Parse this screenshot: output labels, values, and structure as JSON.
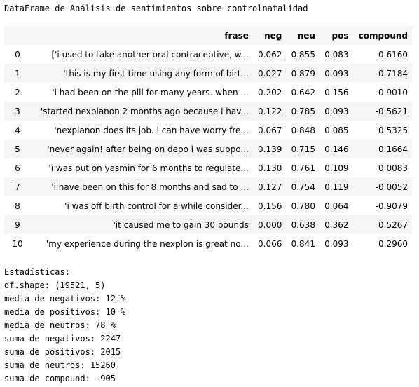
{
  "caption": "DataFrame de Análisis de sentimientos sobre controlnatalidad",
  "table": {
    "columns": [
      "",
      "frase",
      "neg",
      "neu",
      "pos",
      "compound"
    ],
    "rows": [
      [
        "0",
        "['i used to take another oral contraceptive, w...",
        "0.062",
        "0.855",
        "0.083",
        "0.6160"
      ],
      [
        "1",
        "'this is my first time using any form of birt...",
        "0.027",
        "0.879",
        "0.093",
        "0.7184"
      ],
      [
        "2",
        "'i had been on the pill for many years. when ...",
        "0.202",
        "0.642",
        "0.156",
        "-0.9010"
      ],
      [
        "3",
        "'started nexplanon 2 months ago because i hav...",
        "0.122",
        "0.785",
        "0.093",
        "-0.5621"
      ],
      [
        "4",
        "'nexplanon does its job. i can have worry fre...",
        "0.067",
        "0.848",
        "0.085",
        "0.5325"
      ],
      [
        "5",
        "'never again! after being on depo i was suppo...",
        "0.139",
        "0.715",
        "0.146",
        "0.1664"
      ],
      [
        "6",
        "'i was put on yasmin for 6 months to regulate...",
        "0.130",
        "0.761",
        "0.109",
        "0.0083"
      ],
      [
        "7",
        "'i have been on this for 8 months and sad to ...",
        "0.127",
        "0.754",
        "0.119",
        "-0.0052"
      ],
      [
        "8",
        "'i was off birth control for a while consider...",
        "0.156",
        "0.780",
        "0.064",
        "-0.9079"
      ],
      [
        "9",
        "'it caused me to gain 30 pounds",
        "0.000",
        "0.638",
        "0.362",
        "0.5267"
      ],
      [
        "10",
        "'my experience during the nexplon is great no...",
        "0.066",
        "0.841",
        "0.093",
        "0.2960"
      ]
    ]
  },
  "stats": {
    "title": "Estadísticas:",
    "lines": [
      "df.shape: (19521, 5)",
      "media de negativos: 12 %",
      "media de positivos: 10 %",
      "media de neutros: 78 %",
      "suma de negativos: 2247",
      "suma de positivos: 2015",
      "suma de neutros: 15260",
      "suma de compound: -905"
    ]
  }
}
